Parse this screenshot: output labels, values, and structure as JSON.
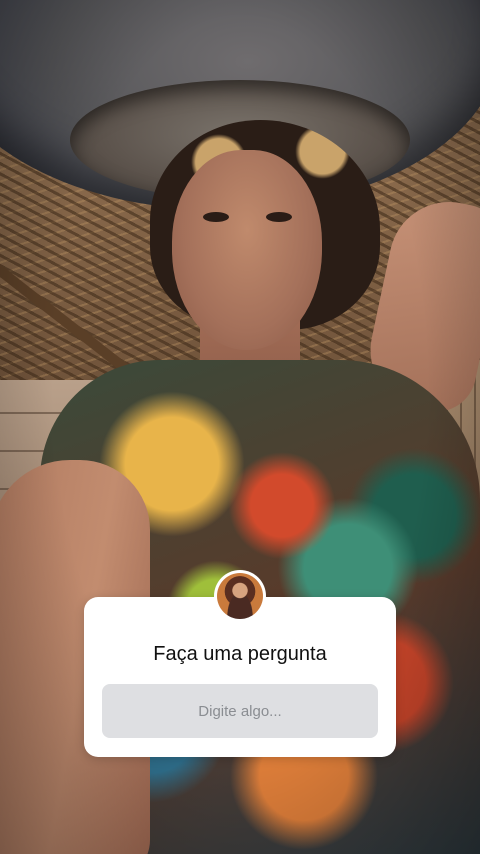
{
  "story": {
    "background_description_icon": "selfie-photo",
    "question_sticker": {
      "title": "Faça uma pergunta",
      "input_placeholder": "Digite algo...",
      "avatar_icon": "profile-avatar-icon"
    }
  },
  "colors": {
    "sticker_background": "#ffffff",
    "input_background": "#dedfe2",
    "placeholder_text": "#8a8d92",
    "title_text": "#111111"
  }
}
